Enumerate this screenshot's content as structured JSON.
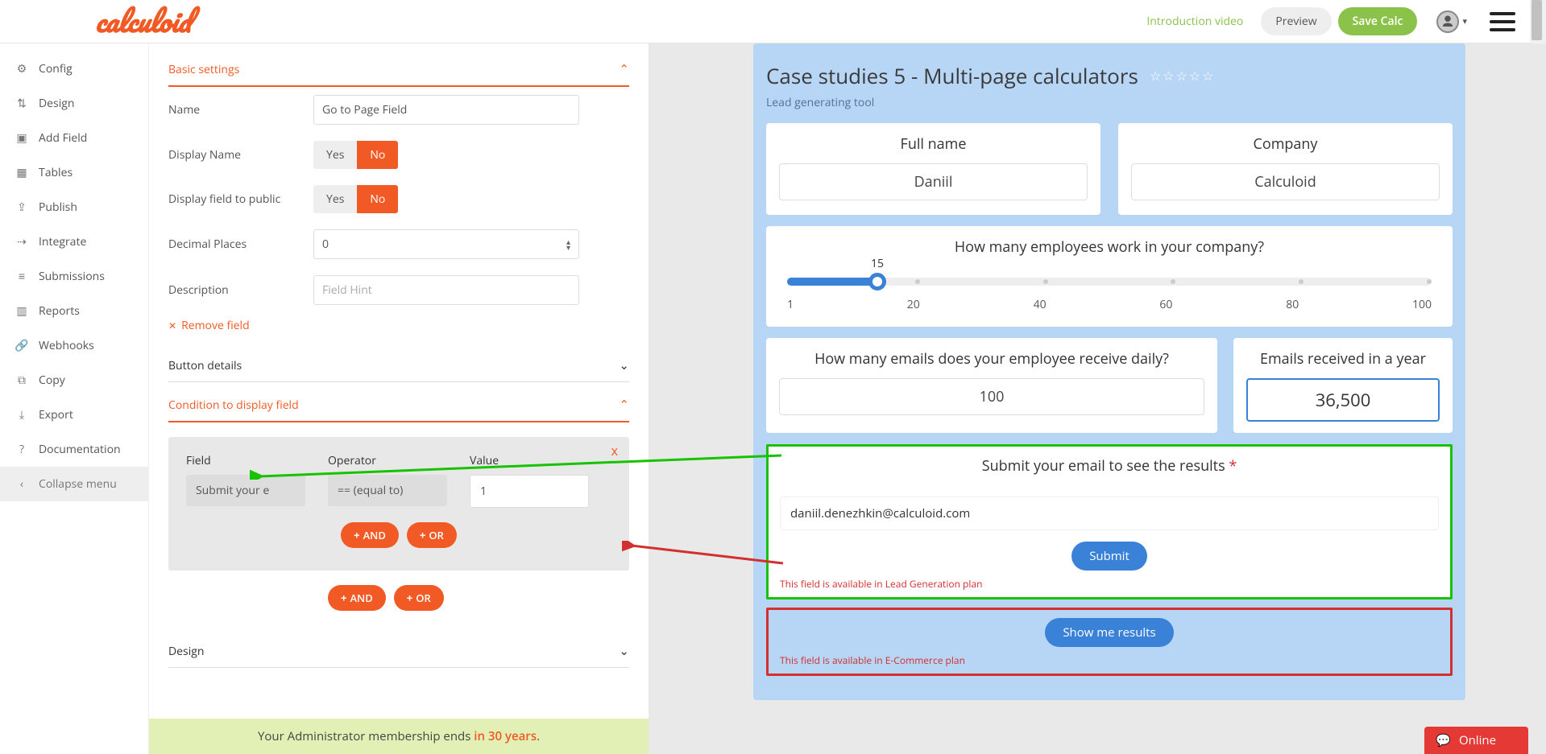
{
  "brand": "calculoid",
  "header": {
    "intro_link": "Introduction video",
    "preview_btn": "Preview",
    "save_btn": "Save Calc"
  },
  "sidebar": {
    "items": [
      {
        "icon": "⚙",
        "label": "Config"
      },
      {
        "icon": "⇅",
        "label": "Design"
      },
      {
        "icon": "▣",
        "label": "Add Field"
      },
      {
        "icon": "▦",
        "label": "Tables"
      },
      {
        "icon": "⇪",
        "label": "Publish"
      },
      {
        "icon": "⇢",
        "label": "Integrate"
      },
      {
        "icon": "≡",
        "label": "Submissions"
      },
      {
        "icon": "▥",
        "label": "Reports"
      },
      {
        "icon": "🔗",
        "label": "Webhooks"
      },
      {
        "icon": "⧉",
        "label": "Copy"
      },
      {
        "icon": "⤓",
        "label": "Export"
      },
      {
        "icon": "?",
        "label": "Documentation"
      }
    ],
    "collapse": {
      "icon": "‹",
      "label": "Collapse menu"
    }
  },
  "config": {
    "sections": {
      "basic": "Basic settings",
      "button": "Button details",
      "condition": "Condition to display field",
      "design": "Design"
    },
    "basic": {
      "name_label": "Name",
      "name_value": "Go to Page Field",
      "display_name_label": "Display Name",
      "display_public_label": "Display field to public",
      "decimal_label": "Decimal Places",
      "decimal_value": "0",
      "desc_label": "Description",
      "desc_placeholder": "Field Hint",
      "yes": "Yes",
      "no": "No",
      "remove": "Remove field"
    },
    "condition": {
      "field_label": "Field",
      "operator_label": "Operator",
      "value_label": "Value",
      "field_val": "Submit your e",
      "operator_val": "== (equal to)",
      "value_val": "1",
      "and": "AND",
      "or": "OR",
      "close": "x"
    }
  },
  "footer": {
    "pre": "Your Administrator membership ends ",
    "accent": "in 30 years",
    "post": "."
  },
  "calc": {
    "title": "Case studies 5 - Multi-page calculators",
    "stars": "☆☆☆☆☆",
    "subtitle": "Lead generating tool",
    "fullname_label": "Full name",
    "fullname_value": "Daniil",
    "company_label": "Company",
    "company_value": "Calculoid",
    "slider": {
      "question": "How many employees work in your company?",
      "value": "15",
      "scale": [
        "1",
        "20",
        "40",
        "60",
        "80",
        "100"
      ],
      "percent": 14
    },
    "emails_daily_label": "How many emails does your employee receive daily?",
    "emails_daily_value": "100",
    "emails_year_label": "Emails received in a year",
    "emails_year_value": "36,500",
    "submit_title": "Submit your email to see the results",
    "email_value": "daniil.denezhkin@calculoid.com",
    "submit_btn": "Submit",
    "plan_leadgen": "This field is available in Lead Generation plan",
    "show_btn": "Show me results",
    "plan_ecom": "This field is available in E-Commerce plan"
  },
  "online": "Online"
}
